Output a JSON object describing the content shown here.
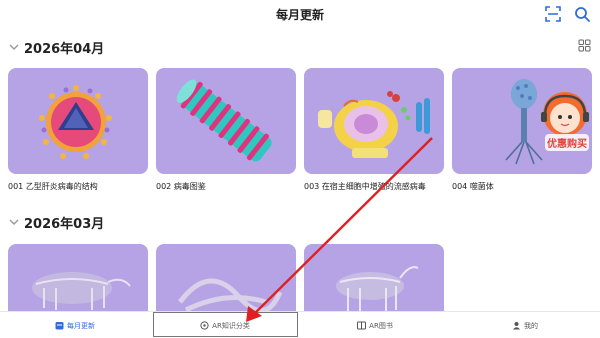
{
  "header": {
    "title": "每月更新",
    "icons": [
      "scan-icon",
      "search-icon"
    ]
  },
  "sections": [
    {
      "title": "2026年04月",
      "items": [
        {
          "caption": "001 乙型肝炎病毒的结构"
        },
        {
          "caption": "002 病毒图鉴"
        },
        {
          "caption": "003 在宿主细胞中增殖的流感病毒"
        },
        {
          "caption": "004 噬菌体"
        }
      ]
    },
    {
      "title": "2026年03月",
      "items": [
        {
          "caption": ""
        },
        {
          "caption": ""
        },
        {
          "caption": ""
        }
      ]
    }
  ],
  "promo": {
    "label": "优惠购买"
  },
  "tabs": [
    {
      "label": "每月更新",
      "active": true
    },
    {
      "label": "AR知识分类",
      "active": false
    },
    {
      "label": "AR图书",
      "active": false
    },
    {
      "label": "我的",
      "active": false
    }
  ],
  "colors": {
    "card_bg": "#b6a3e5",
    "accent": "#2f6be0",
    "annotation_arrow": "#e02020"
  }
}
